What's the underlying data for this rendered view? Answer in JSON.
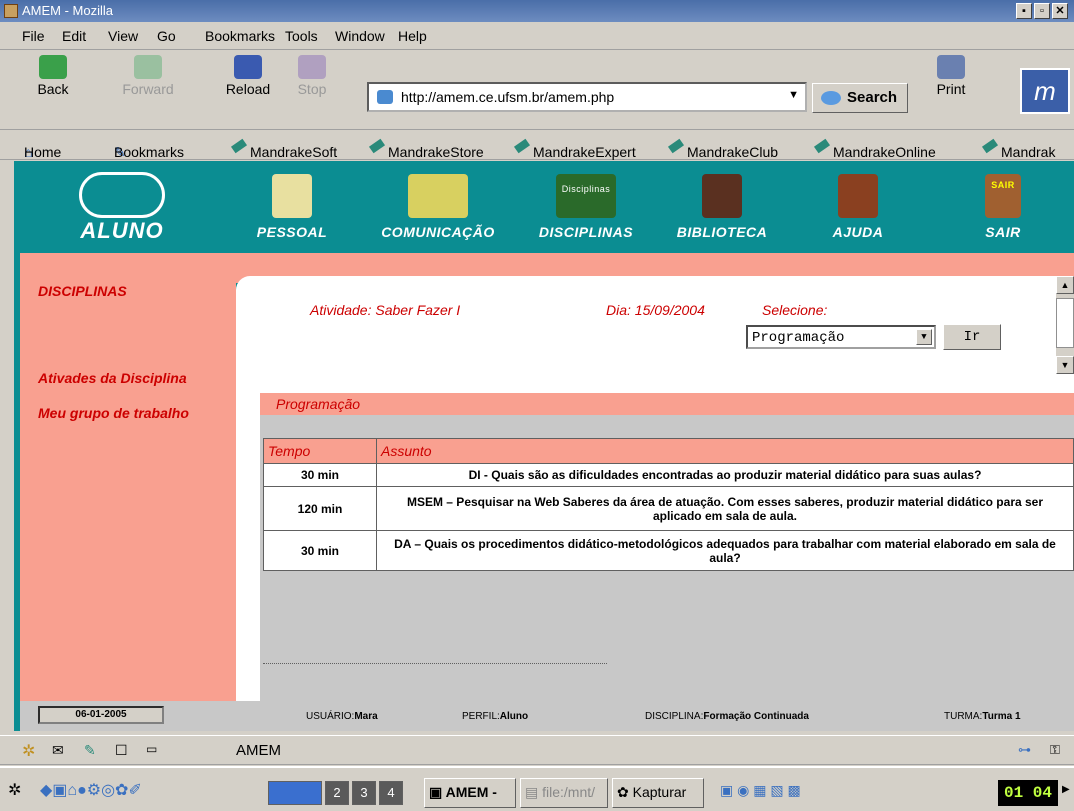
{
  "window": {
    "title": "AMEM - Mozilla"
  },
  "menu": {
    "items": [
      "File",
      "Edit",
      "View",
      "Go",
      "Bookmarks",
      "Tools",
      "Window",
      "Help"
    ]
  },
  "nav": {
    "back": "Back",
    "forward": "Forward",
    "reload": "Reload",
    "stop": "Stop",
    "url": "http://amem.ce.ufsm.br/amem.php",
    "search": "Search",
    "print": "Print"
  },
  "bookmarks": {
    "items": [
      "Home",
      "Bookmarks",
      "MandrakeSoft",
      "MandrakeStore",
      "MandrakeExpert",
      "MandrakeClub",
      "MandrakeOnline",
      "Mandrak"
    ]
  },
  "site": {
    "logo": "ALUNO",
    "nav": [
      "PESSOAL",
      "COMUNICAÇÃO",
      "DISCIPLINAS",
      "BIBLIOTECA",
      "AJUDA",
      "SAIR"
    ],
    "disciplinas_icon_text": "Disciplinas",
    "sair_icon_text": "SAIR"
  },
  "sidebar": {
    "title": "DISCIPLINAS",
    "items": [
      "Ativades da Disciplina",
      "Meu grupo de trabalho"
    ]
  },
  "header": {
    "atividade": "Atividade: Saber Fazer I",
    "dia": "Dia: 15/09/2004",
    "selecione": "Selecione:",
    "select_value": "Programação",
    "ir": "Ir"
  },
  "programacao": {
    "label": "Programação"
  },
  "table": {
    "headers": [
      "Tempo",
      "Assunto"
    ],
    "rows": [
      {
        "tempo": "30 min",
        "assunto": "DI - Quais são as dificuldades encontradas ao produzir material didático para suas aulas?"
      },
      {
        "tempo": "120 min",
        "assunto": "MSEM – Pesquisar na Web Saberes da área de atuação. Com esses saberes, produzir material didático para ser aplicado em sala de aula."
      },
      {
        "tempo": "30 min",
        "assunto": "DA – Quais os procedimentos didático-metodológicos adequados para trabalhar com material elaborado em sala de aula?"
      }
    ]
  },
  "status": {
    "date": "06-01-2005",
    "usuario_label": "USUÁRIO:",
    "usuario": "Mara",
    "perfil_label": "PERFIL:",
    "perfil": "Aluno",
    "disciplina_label": "DISCIPLINA:",
    "disciplina": "Formação Continuada",
    "turma_label": "TURMA:",
    "turma": "Turma 1"
  },
  "browser_status": {
    "text": "AMEM"
  },
  "taskbar": {
    "desktops": [
      "2",
      "3",
      "4"
    ],
    "tasks": [
      "AMEM -",
      "file:/mnt/",
      "Kapturar"
    ],
    "clock": "01 04"
  },
  "colors": {
    "teal": "#0b8d92",
    "salmon": "#f9a090",
    "red_text": "#cc0000"
  }
}
